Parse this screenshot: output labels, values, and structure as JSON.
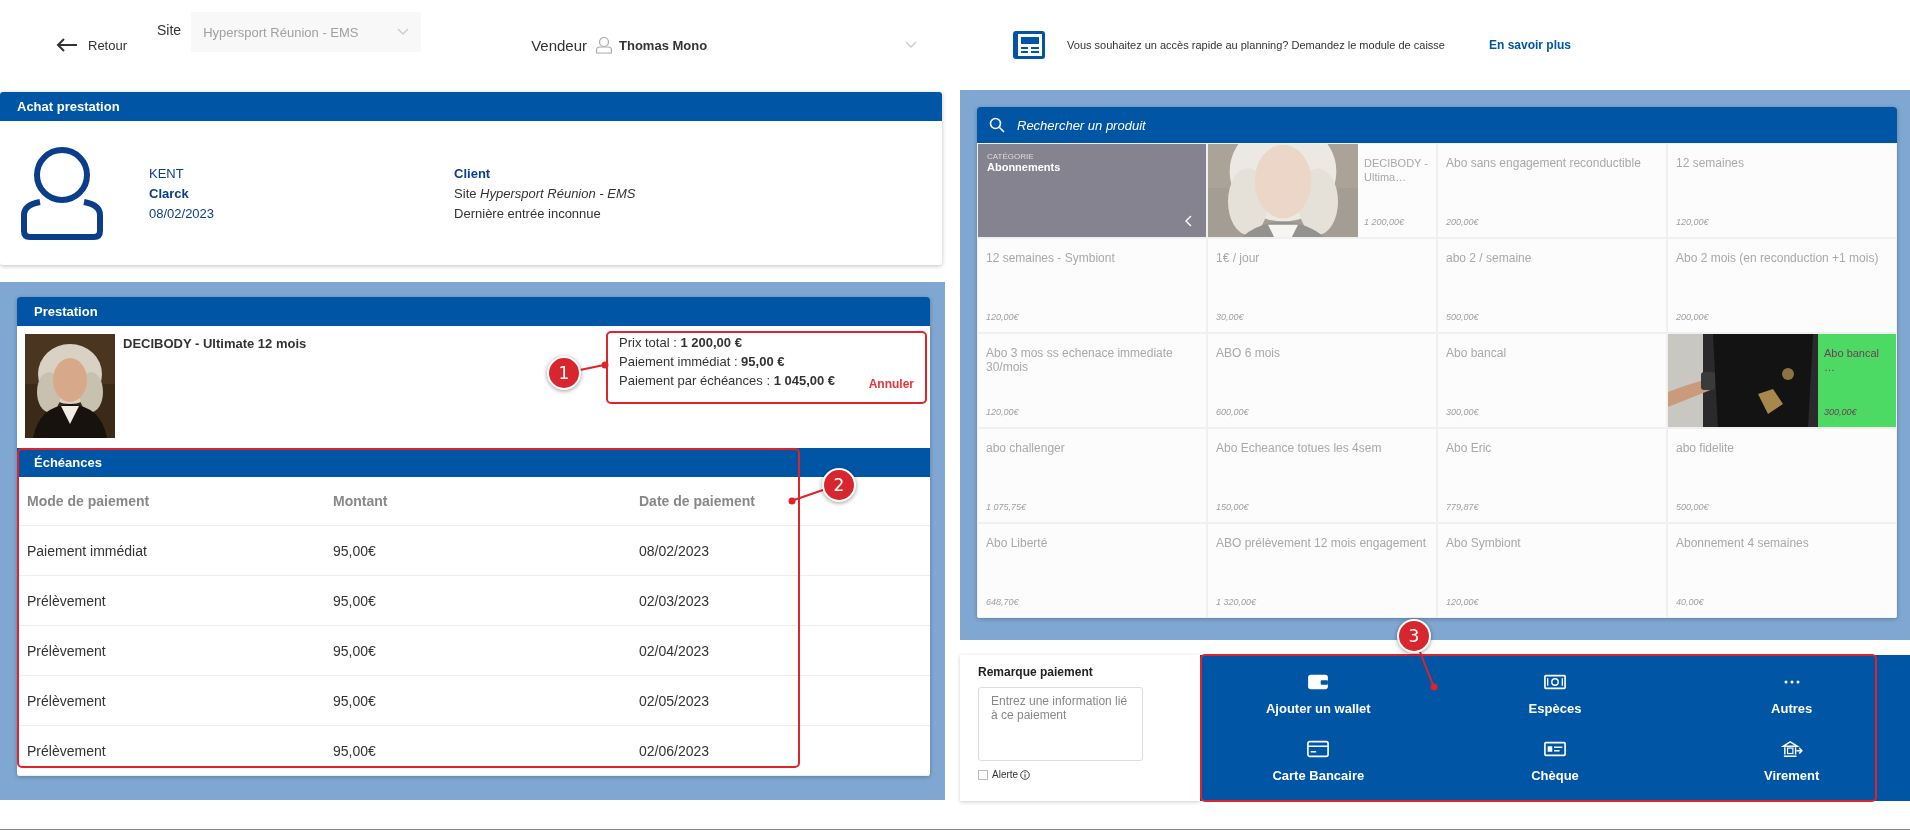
{
  "topbar": {
    "back": "Retour",
    "site_label": "Site",
    "site_value": "Hypersport Réunion - EMS",
    "seller_label": "Vendeur",
    "seller_value": "Thomas Mono",
    "promo_text": "Vous souhaitez un accès rapide au planning? Demandez le module de caisse",
    "promo_link": "En savoir plus"
  },
  "customer": {
    "title": "Achat prestation",
    "last_name": "KENT",
    "first_name": "Clarck",
    "date": "08/02/2023",
    "status": "Client",
    "site": "Site *Hypersport Réunion - EMS*",
    "last_entry": "Dernière entrée inconnue"
  },
  "prestation": {
    "title": "Prestation",
    "product": "DECIBODY - Ultimate 12 mois",
    "prices": [
      "Prix total :  **1 200,00 €**",
      "Paiement immédiat :  **95,00 €**",
      "Paiement par échéances :  **1 045,00 €**"
    ],
    "cancel": "Annuler",
    "schedule": {
      "title": "Échéances",
      "columns": [
        "Mode de paiement",
        "Montant",
        "Date de paiement"
      ],
      "rows": [
        [
          "Paiement immédiat",
          "95,00€",
          "08/02/2023"
        ],
        [
          "Prélèvement",
          "95,00€",
          "02/03/2023"
        ],
        [
          "Prélèvement",
          "95,00€",
          "02/04/2023"
        ],
        [
          "Prélèvement",
          "95,00€",
          "02/05/2023"
        ],
        [
          "Prélèvement",
          "95,00€",
          "02/06/2023"
        ]
      ]
    }
  },
  "products": {
    "search_placeholder": "Rechercher un produit",
    "items": [
      {
        "kind": "category",
        "label": "CATÉGORIE",
        "name": "Abonnements"
      },
      {
        "kind": "product",
        "name": "DECIBODY - Ultima…",
        "price": "1 200,00€",
        "picture": true,
        "selected": false
      },
      {
        "kind": "product",
        "name": "Abo sans engagement reconductible",
        "price": "200,00€",
        "picture": false,
        "selected": false
      },
      {
        "kind": "product",
        "name": "12 semaines",
        "price": "120,00€",
        "picture": false,
        "selected": false
      },
      {
        "kind": "product",
        "name": "12 semaines - Symbiont",
        "price": "120,00€",
        "picture": false,
        "selected": false
      },
      {
        "kind": "product",
        "name": "1€ / jour",
        "price": "30,00€",
        "picture": false,
        "selected": false
      },
      {
        "kind": "product",
        "name": "abo 2 / semaine",
        "price": "500,00€",
        "picture": false,
        "selected": false
      },
      {
        "kind": "product",
        "name": "Abo 2 mois (en reconduction +1 mois)",
        "price": "200,00€",
        "picture": false,
        "selected": false
      },
      {
        "kind": "product",
        "name": "Abo 3 mos ss echenace immediate 30/mois",
        "price": "120,00€",
        "picture": false,
        "selected": false
      },
      {
        "kind": "product",
        "name": "ABO 6 mois",
        "price": "600,00€",
        "picture": false,
        "selected": false
      },
      {
        "kind": "product",
        "name": "Abo bancal",
        "price": "300,00€",
        "picture": false,
        "selected": false
      },
      {
        "kind": "product",
        "name": "Abo bancal …",
        "price": "300,00€",
        "picture": true,
        "selected": true
      },
      {
        "kind": "product",
        "name": "abo challenger",
        "price": "1 075,75€",
        "picture": false,
        "selected": false
      },
      {
        "kind": "product",
        "name": "Abo Echeance totues les 4sem",
        "price": "150,00€",
        "picture": false,
        "selected": false
      },
      {
        "kind": "product",
        "name": "Abo Eric",
        "price": "779,87€",
        "picture": false,
        "selected": false
      },
      {
        "kind": "product",
        "name": "abo fidelite",
        "price": "500,00€",
        "picture": false,
        "selected": false
      },
      {
        "kind": "product",
        "name": "Abo Liberté",
        "price": "648,70€",
        "picture": false,
        "selected": false
      },
      {
        "kind": "product",
        "name": "ABO prélèvement 12 mois engagement",
        "price": "1 320,00€",
        "picture": false,
        "selected": false
      },
      {
        "kind": "product",
        "name": "Abo Symbiont",
        "price": "120,00€",
        "picture": false,
        "selected": false
      },
      {
        "kind": "product",
        "name": "Abonnement 4 semaines",
        "price": "40,00€",
        "picture": false,
        "selected": false
      }
    ]
  },
  "payment": {
    "remark_label": "Remarque paiement",
    "remark_placeholder": "Entrez une information lié à ce paiement",
    "alert_label": "Alerte",
    "alert_checked": false,
    "methods": [
      {
        "kind": "wallet",
        "label": "Ajouter un wallet"
      },
      {
        "kind": "cash",
        "label": "Espèces"
      },
      {
        "kind": "more",
        "label": "Autres"
      },
      {
        "kind": "card",
        "label": "Carte Bancaire"
      },
      {
        "kind": "cheque",
        "label": "Chèque"
      },
      {
        "kind": "transfer",
        "label": "Virement"
      }
    ]
  },
  "annotations": [
    {
      "label": "1"
    },
    {
      "label": "2"
    },
    {
      "label": "3"
    }
  ]
}
